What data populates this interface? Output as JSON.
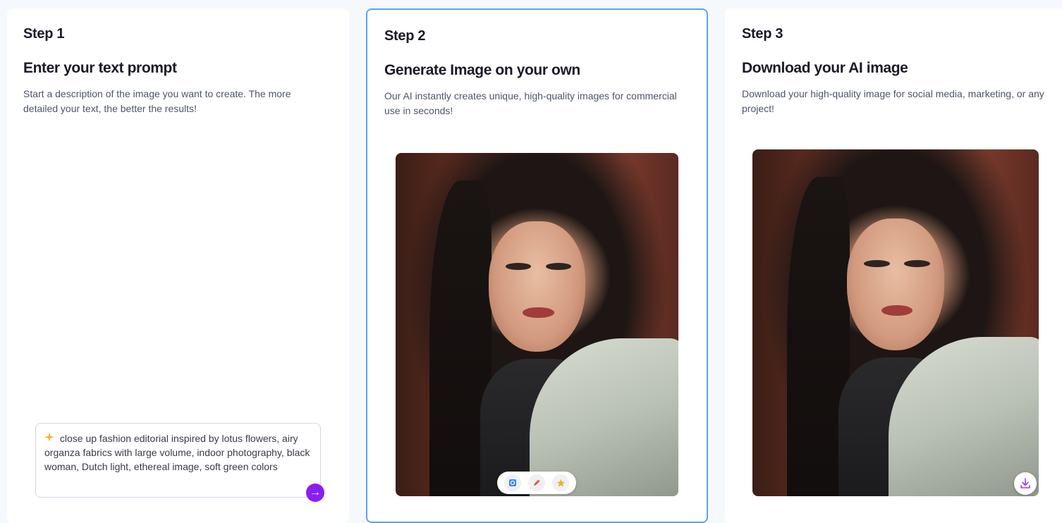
{
  "steps": [
    {
      "label": "Step 1",
      "title": "Enter your text prompt",
      "description": "Start a description of the image you want to create. The more detailed your text, the better the results!"
    },
    {
      "label": "Step 2",
      "title": "Generate Image on your own",
      "description": "Our AI instantly creates unique, high-quality images for commercial use in seconds!"
    },
    {
      "label": "Step 3",
      "title": "Download your AI image",
      "description": "Download your high-quality image for social media, marketing, or any project!"
    }
  ],
  "prompt": {
    "icon": "sparkle-icon",
    "text": "close up fashion editorial inspired by lotus flowers, airy organza fabrics with large volume, indoor photography, black woman, Dutch light, ethereal image, soft green colors",
    "send_icon": "arrow-right-icon"
  },
  "toolbar": {
    "icons": [
      "regenerate-icon",
      "pencil-icon",
      "star-icon"
    ]
  },
  "download": {
    "icon": "download-icon"
  },
  "colors": {
    "accent_purple": "#8b1ef0",
    "active_border": "#5aa5f0",
    "page_bg": "#f5f8fd"
  }
}
